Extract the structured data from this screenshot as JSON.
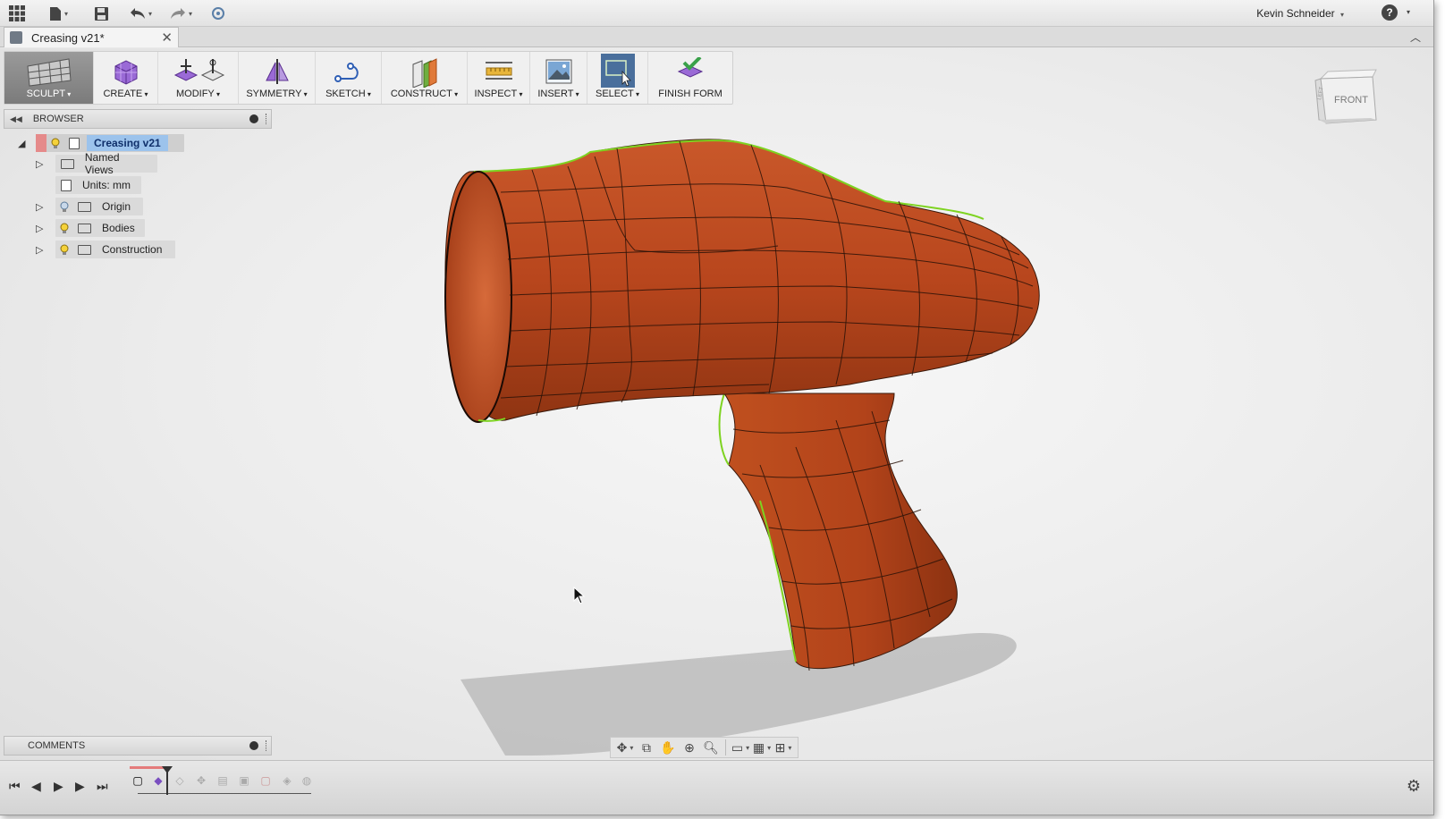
{
  "app": {
    "user_name": "Kevin Schneider",
    "help_label": "?",
    "accent_color": "#3e6fb3"
  },
  "document_tab": {
    "title": "Creasing v21*"
  },
  "toolbar": {
    "groups": [
      {
        "label": "SCULPT",
        "icon": "sculpt-grid-icon"
      },
      {
        "label": "CREATE",
        "icon": "create-box-icon"
      },
      {
        "label": "MODIFY",
        "icon": "modify-tools-icon"
      },
      {
        "label": "SYMMETRY",
        "icon": "symmetry-icon"
      },
      {
        "label": "SKETCH",
        "icon": "sketch-icon"
      },
      {
        "label": "CONSTRUCT",
        "icon": "construct-plane-icon"
      },
      {
        "label": "INSPECT",
        "icon": "ruler-icon"
      },
      {
        "label": "INSERT",
        "icon": "image-icon"
      },
      {
        "label": "SELECT",
        "icon": "select-cursor-icon"
      },
      {
        "label": "FINISH FORM",
        "icon": "finish-form-icon"
      }
    ]
  },
  "viewcube": {
    "face_label": "FRONT",
    "side_label": "LEFT"
  },
  "browser": {
    "title": "BROWSER",
    "root": "Creasing v21",
    "items": [
      {
        "label": "Named Views"
      },
      {
        "label": "Units: mm"
      },
      {
        "label": "Origin"
      },
      {
        "label": "Bodies"
      },
      {
        "label": "Construction"
      }
    ]
  },
  "comments": {
    "title": "COMMENTS"
  },
  "colors": {
    "model_body": "#b8461d",
    "model_edge_highlight": "#7ed321",
    "select_active": "#4a6f9c"
  }
}
